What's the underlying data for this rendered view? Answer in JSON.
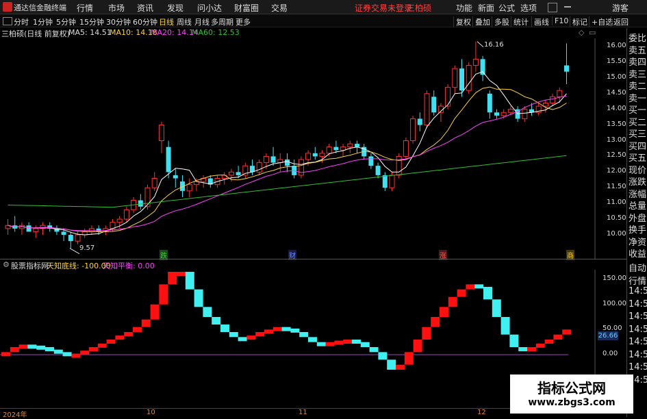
{
  "app": {
    "brand": "通达信金融终端"
  },
  "menu": {
    "items": [
      "行情",
      "市场",
      "资讯",
      "发现",
      "问小达",
      "财富圈",
      "交易"
    ],
    "notice": "证券交易未登录",
    "stock": "三柏硕",
    "right": [
      "功能",
      "新面",
      "公式",
      "选项",
      "游客"
    ]
  },
  "toolbar": {
    "periods": [
      "分时",
      "1分钟",
      "5分钟",
      "15分钟",
      "30分钟",
      "60分钟",
      "日线",
      "周线",
      "月线",
      "多周期",
      "更多"
    ],
    "active": "日线",
    "right": [
      "复权",
      "叠加",
      "多股",
      "统计",
      "画线",
      "F10",
      "标记",
      "+自选",
      "返回"
    ]
  },
  "info": {
    "title": "三柏硕(日线 前复权)",
    "ma5": "MA5: 14.51",
    "ma10": "MA10: 14.18",
    "ma20": "MA20: 14.14",
    "ma60": "MA60: 12.53"
  },
  "colors": {
    "ma5": "#ffffff",
    "ma10": "#ffd23c",
    "ma20": "#ff40ff",
    "ma60": "#30c030",
    "up": "#ff3030",
    "down": "#40e0f0"
  },
  "price_axis": [
    "16.00",
    "15.50",
    "15.00",
    "14.50",
    "14.00",
    "13.50",
    "13.00",
    "12.50",
    "12.00",
    "11.50",
    "11.00",
    "10.50",
    "10.00"
  ],
  "annotations": {
    "high": "16.16",
    "low": "9.57"
  },
  "events": [
    {
      "label": "跌",
      "color": "#30c030"
    },
    {
      "label": "财",
      "color": "#6688ff"
    },
    {
      "label": "涨",
      "color": "#ff5050"
    },
    {
      "label": "商",
      "color": "#ffcc00"
    }
  ],
  "indicator": {
    "site": "股票指标网",
    "line1": "天知底线: -100.00",
    "line2": "天知平衡: 0.00",
    "axis": [
      "150.00",
      "100.00",
      "50.00",
      "0.00"
    ],
    "current": "26.66"
  },
  "right_panel": [
    "委比",
    "卖五",
    "卖四",
    "卖三",
    "卖二",
    "卖一",
    "买一",
    "买二",
    "买三",
    "买四",
    "买五",
    "现价",
    "涨跌",
    "涨幅",
    "总量",
    "外盘",
    "换手",
    "净资",
    "收益",
    "自动",
    "行情",
    "14:50",
    "14:50",
    "14:50",
    "14:50",
    "14:50",
    "14:50",
    "14:50",
    "14:50"
  ],
  "dates": [
    "2024年",
    "10",
    "11",
    "12"
  ],
  "watermark": {
    "line1": "指标公式网",
    "line2": "www.zbgs3.com"
  },
  "chart_data": {
    "type": "candlestick",
    "ylim": [
      9.5,
      16.3
    ],
    "candles": [
      [
        10.2,
        10.5,
        10.0,
        10.3
      ],
      [
        10.3,
        10.6,
        10.1,
        10.2
      ],
      [
        10.2,
        10.4,
        10.0,
        10.3
      ],
      [
        10.3,
        10.4,
        10.1,
        10.1
      ],
      [
        10.1,
        10.3,
        9.9,
        10.2
      ],
      [
        10.2,
        10.4,
        10.0,
        10.3
      ],
      [
        10.3,
        10.4,
        10.1,
        10.2
      ],
      [
        10.2,
        10.3,
        10.0,
        10.1
      ],
      [
        10.1,
        10.2,
        9.8,
        10.0
      ],
      [
        10.0,
        10.1,
        9.57,
        9.8
      ],
      [
        9.8,
        10.1,
        9.7,
        10.0
      ],
      [
        10.0,
        10.2,
        9.9,
        10.1
      ],
      [
        10.1,
        10.3,
        10.0,
        10.2
      ],
      [
        10.2,
        10.3,
        10.0,
        10.1
      ],
      [
        10.1,
        10.3,
        10.0,
        10.2
      ],
      [
        10.2,
        10.5,
        10.1,
        10.4
      ],
      [
        10.4,
        10.6,
        10.2,
        10.5
      ],
      [
        10.5,
        10.9,
        10.4,
        10.8
      ],
      [
        10.8,
        11.2,
        10.7,
        11.1
      ],
      [
        11.1,
        11.3,
        10.8,
        10.9
      ],
      [
        10.9,
        11.6,
        10.8,
        11.5
      ],
      [
        11.5,
        12.0,
        11.4,
        11.8
      ],
      [
        13.0,
        13.6,
        12.6,
        13.5
      ],
      [
        12.8,
        13.0,
        11.8,
        12.0
      ],
      [
        11.9,
        12.1,
        11.5,
        11.8
      ],
      [
        11.7,
        11.9,
        11.2,
        11.4
      ],
      [
        11.4,
        11.8,
        11.2,
        11.6
      ],
      [
        11.6,
        11.8,
        11.4,
        11.7
      ],
      [
        11.7,
        11.9,
        11.5,
        11.8
      ],
      [
        11.8,
        11.9,
        11.5,
        11.6
      ],
      [
        11.6,
        11.9,
        11.5,
        11.8
      ],
      [
        11.8,
        12.0,
        11.6,
        11.9
      ],
      [
        11.9,
        12.1,
        11.7,
        12.0
      ],
      [
        12.0,
        12.2,
        11.8,
        11.9
      ],
      [
        11.9,
        12.3,
        11.8,
        12.2
      ],
      [
        12.2,
        12.4,
        11.9,
        12.0
      ],
      [
        12.0,
        12.4,
        11.9,
        12.3
      ],
      [
        12.3,
        12.6,
        12.1,
        12.5
      ],
      [
        12.5,
        12.8,
        12.2,
        12.3
      ],
      [
        12.3,
        12.6,
        12.0,
        12.4
      ],
      [
        12.4,
        12.6,
        12.0,
        12.2
      ],
      [
        12.2,
        12.4,
        11.8,
        11.9
      ],
      [
        11.9,
        12.5,
        11.8,
        12.4
      ],
      [
        12.4,
        12.7,
        12.2,
        12.6
      ],
      [
        12.6,
        12.8,
        12.4,
        12.5
      ],
      [
        12.5,
        12.7,
        12.3,
        12.6
      ],
      [
        12.6,
        12.9,
        12.5,
        12.8
      ],
      [
        12.8,
        13.0,
        12.6,
        12.7
      ],
      [
        12.7,
        12.9,
        12.5,
        12.8
      ],
      [
        12.8,
        13.0,
        12.6,
        12.9
      ],
      [
        12.9,
        13.0,
        12.6,
        12.8
      ],
      [
        12.8,
        12.9,
        12.4,
        12.5
      ],
      [
        12.5,
        12.6,
        12.1,
        12.2
      ],
      [
        12.2,
        12.3,
        11.8,
        11.9
      ],
      [
        11.9,
        12.0,
        11.4,
        11.5
      ],
      [
        11.5,
        12.0,
        11.4,
        11.9
      ],
      [
        11.9,
        12.6,
        11.8,
        12.5
      ],
      [
        12.5,
        13.1,
        12.4,
        13.0
      ],
      [
        13.0,
        13.8,
        12.9,
        13.7
      ],
      [
        13.7,
        13.9,
        13.3,
        13.5
      ],
      [
        13.5,
        14.6,
        13.4,
        14.5
      ],
      [
        14.4,
        14.6,
        13.8,
        13.9
      ],
      [
        13.9,
        14.2,
        13.6,
        14.1
      ],
      [
        14.1,
        14.8,
        14.0,
        14.7
      ],
      [
        14.7,
        15.4,
        14.5,
        15.3
      ],
      [
        15.3,
        15.6,
        14.4,
        14.6
      ],
      [
        14.6,
        15.5,
        14.5,
        15.4
      ],
      [
        15.4,
        16.16,
        15.2,
        15.6
      ],
      [
        15.6,
        15.7,
        14.9,
        15.1
      ],
      [
        14.5,
        14.6,
        13.7,
        13.9
      ],
      [
        13.9,
        14.0,
        13.7,
        13.8
      ],
      [
        13.8,
        14.0,
        13.7,
        13.9
      ],
      [
        13.9,
        14.1,
        13.8,
        14.0
      ],
      [
        14.0,
        14.1,
        13.6,
        13.7
      ],
      [
        13.7,
        14.1,
        13.6,
        14.0
      ],
      [
        14.0,
        14.2,
        13.8,
        13.9
      ],
      [
        13.9,
        14.2,
        13.8,
        14.1
      ],
      [
        14.1,
        14.3,
        13.9,
        14.2
      ],
      [
        14.2,
        14.5,
        14.1,
        14.4
      ],
      [
        14.4,
        14.7,
        14.2,
        14.6
      ],
      [
        15.4,
        16.1,
        14.8,
        15.2
      ]
    ],
    "ma_windows": [
      5,
      10,
      20,
      60
    ]
  }
}
